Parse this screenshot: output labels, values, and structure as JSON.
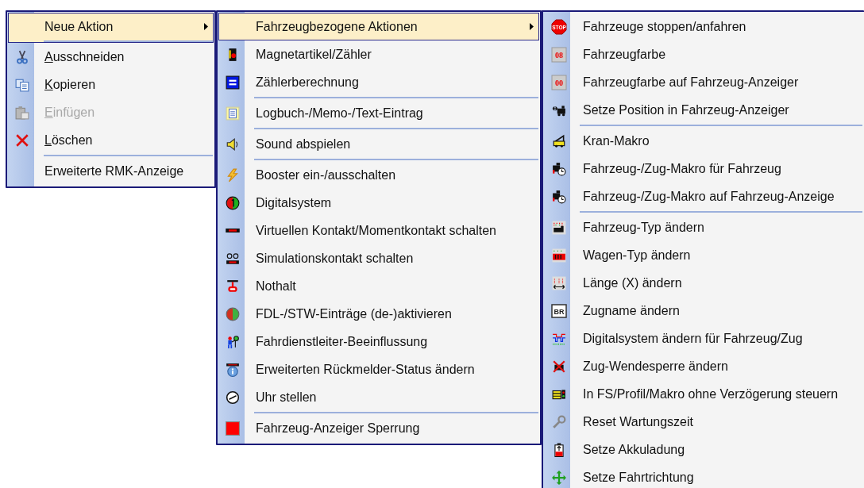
{
  "menus": [
    {
      "items": [
        {
          "label": "Neue Aktion",
          "mnemonic": false,
          "selected": true,
          "disabled": false,
          "submenu": true,
          "separator_after": true
        },
        {
          "label": "Ausschneiden",
          "mnemonic": true,
          "selected": false,
          "disabled": false,
          "submenu": false,
          "separator_after": false
        },
        {
          "label": "Kopieren",
          "mnemonic": true,
          "selected": false,
          "disabled": false,
          "submenu": false,
          "separator_after": false
        },
        {
          "label": "Einfügen",
          "mnemonic": true,
          "selected": false,
          "disabled": true,
          "submenu": false,
          "separator_after": false
        },
        {
          "label": "Löschen",
          "mnemonic": true,
          "selected": false,
          "disabled": false,
          "submenu": false,
          "separator_after": true
        },
        {
          "label": "Erweiterte RMK-Anzeige",
          "mnemonic": false,
          "selected": false,
          "disabled": false,
          "submenu": false,
          "separator_after": false
        }
      ]
    },
    {
      "items": [
        {
          "label": "Fahrzeugbezogene Aktionen",
          "mnemonic": false,
          "selected": true,
          "disabled": false,
          "submenu": true,
          "separator_after": false
        },
        {
          "label": "Magnetartikel/Zähler",
          "mnemonic": false,
          "selected": false,
          "disabled": false,
          "submenu": false,
          "separator_after": false
        },
        {
          "label": "Zählerberechnung",
          "mnemonic": false,
          "selected": false,
          "disabled": false,
          "submenu": false,
          "separator_after": true
        },
        {
          "label": "Logbuch-/Memo-/Text-Eintrag",
          "mnemonic": false,
          "selected": false,
          "disabled": false,
          "submenu": false,
          "separator_after": true
        },
        {
          "label": "Sound abspielen",
          "mnemonic": false,
          "selected": false,
          "disabled": false,
          "submenu": false,
          "separator_after": true
        },
        {
          "label": "Booster ein-/ausschalten",
          "mnemonic": false,
          "selected": false,
          "disabled": false,
          "submenu": false,
          "separator_after": false
        },
        {
          "label": "Digitalsystem",
          "mnemonic": false,
          "selected": false,
          "disabled": false,
          "submenu": false,
          "separator_after": false
        },
        {
          "label": "Virtuellen Kontakt/Momentkontakt schalten",
          "mnemonic": false,
          "selected": false,
          "disabled": false,
          "submenu": false,
          "separator_after": false
        },
        {
          "label": "Simulationskontakt schalten",
          "mnemonic": false,
          "selected": false,
          "disabled": false,
          "submenu": false,
          "separator_after": false
        },
        {
          "label": "Nothalt",
          "mnemonic": false,
          "selected": false,
          "disabled": false,
          "submenu": false,
          "separator_after": false
        },
        {
          "label": "FDL-/STW-Einträge (de-)aktivieren",
          "mnemonic": false,
          "selected": false,
          "disabled": false,
          "submenu": false,
          "separator_after": false
        },
        {
          "label": "Fahrdienstleiter-Beeinflussung",
          "mnemonic": false,
          "selected": false,
          "disabled": false,
          "submenu": false,
          "separator_after": false
        },
        {
          "label": "Erweiterten Rückmelder-Status ändern",
          "mnemonic": false,
          "selected": false,
          "disabled": false,
          "submenu": false,
          "separator_after": false
        },
        {
          "label": "Uhr stellen",
          "mnemonic": false,
          "selected": false,
          "disabled": false,
          "submenu": false,
          "separator_after": true
        },
        {
          "label": "Fahrzeug-Anzeiger Sperrung",
          "mnemonic": false,
          "selected": false,
          "disabled": false,
          "submenu": false,
          "separator_after": false
        }
      ]
    },
    {
      "items": [
        {
          "label": "Fahrzeuge stoppen/anfahren",
          "icon_text": "STOP",
          "mnemonic": false,
          "selected": false,
          "disabled": false,
          "submenu": false,
          "separator_after": false
        },
        {
          "label": "Fahrzeugfarbe",
          "icon_text": "08",
          "mnemonic": false,
          "selected": false,
          "disabled": false,
          "submenu": false,
          "separator_after": false
        },
        {
          "label": "Fahrzeugfarbe auf Fahrzeug-Anzeiger",
          "icon_text": "00",
          "mnemonic": false,
          "selected": false,
          "disabled": false,
          "submenu": false,
          "separator_after": false
        },
        {
          "label": "Setze Position in Fahrzeug-Anzeiger",
          "mnemonic": false,
          "selected": false,
          "disabled": false,
          "submenu": false,
          "separator_after": true
        },
        {
          "label": "Kran-Makro",
          "mnemonic": false,
          "selected": false,
          "disabled": false,
          "submenu": false,
          "separator_after": false
        },
        {
          "label": "Fahrzeug-/Zug-Makro für Fahrzeug",
          "mnemonic": false,
          "selected": false,
          "disabled": false,
          "submenu": false,
          "separator_after": false
        },
        {
          "label": "Fahrzeug-/Zug-Makro auf Fahrzeug-Anzeige",
          "mnemonic": false,
          "selected": false,
          "disabled": false,
          "submenu": false,
          "separator_after": true
        },
        {
          "label": "Fahrzeug-Typ ändern",
          "mnemonic": false,
          "selected": false,
          "disabled": false,
          "submenu": false,
          "separator_after": false
        },
        {
          "label": "Wagen-Typ ändern",
          "mnemonic": false,
          "selected": false,
          "disabled": false,
          "submenu": false,
          "separator_after": false
        },
        {
          "label": "Länge (X) ändern",
          "mnemonic": false,
          "selected": false,
          "disabled": false,
          "submenu": false,
          "separator_after": false
        },
        {
          "label": "Zugname ändern",
          "icon_text": "BR",
          "mnemonic": false,
          "selected": false,
          "disabled": false,
          "submenu": false,
          "separator_after": false
        },
        {
          "label": "Digitalsystem ändern für Fahrzeug/Zug",
          "mnemonic": false,
          "selected": false,
          "disabled": false,
          "submenu": false,
          "separator_after": false
        },
        {
          "label": "Zug-Wendesperre ändern",
          "mnemonic": false,
          "selected": false,
          "disabled": false,
          "submenu": false,
          "separator_after": false
        },
        {
          "label": "In FS/Profil/Makro ohne Verzögerung steuern",
          "mnemonic": false,
          "selected": false,
          "disabled": false,
          "submenu": false,
          "separator_after": false
        },
        {
          "label": "Reset Wartungszeit",
          "mnemonic": false,
          "selected": false,
          "disabled": false,
          "submenu": false,
          "separator_after": false
        },
        {
          "label": "Setze Akkuladung",
          "mnemonic": false,
          "selected": false,
          "disabled": false,
          "submenu": false,
          "separator_after": false
        },
        {
          "label": "Setze Fahrtrichtung",
          "mnemonic": false,
          "selected": false,
          "disabled": false,
          "submenu": false,
          "separator_after": false
        }
      ]
    }
  ]
}
